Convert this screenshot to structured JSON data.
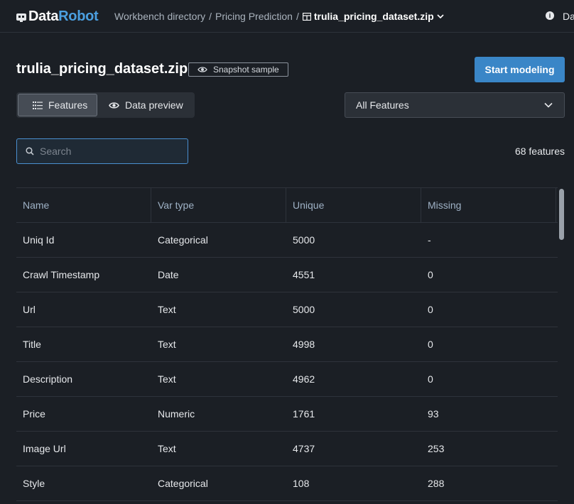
{
  "nav": {
    "logo_data": "Data",
    "logo_robot": "Robot",
    "crumb_1": "Workbench directory",
    "crumb_2": "Pricing Prediction",
    "sep": "/",
    "crumb_current": "trulia_pricing_dataset.zip",
    "user_trunc": "Da"
  },
  "header": {
    "title": "trulia_pricing_dataset.zip",
    "badge": "Snapshot sample",
    "start_button": "Start modeling"
  },
  "toggle": {
    "features": "Features",
    "data_preview": "Data preview"
  },
  "filter": {
    "selected": "All Features"
  },
  "search": {
    "placeholder": "Search",
    "value": ""
  },
  "feature_count": "68 features",
  "table": {
    "columns": [
      "Name",
      "Var type",
      "Unique",
      "Missing"
    ],
    "rows": [
      [
        "Uniq Id",
        "Categorical",
        "5000",
        "-"
      ],
      [
        "Crawl Timestamp",
        "Date",
        "4551",
        "0"
      ],
      [
        "Url",
        "Text",
        "5000",
        "0"
      ],
      [
        "Title",
        "Text",
        "4998",
        "0"
      ],
      [
        "Description",
        "Text",
        "4962",
        "0"
      ],
      [
        "Price",
        "Numeric",
        "1761",
        "93"
      ],
      [
        "Image Url",
        "Text",
        "4737",
        "253"
      ],
      [
        "Style",
        "Categorical",
        "108",
        "288"
      ]
    ]
  },
  "colors": {
    "accent": "#3a86c7",
    "background": "#1b1f25"
  }
}
